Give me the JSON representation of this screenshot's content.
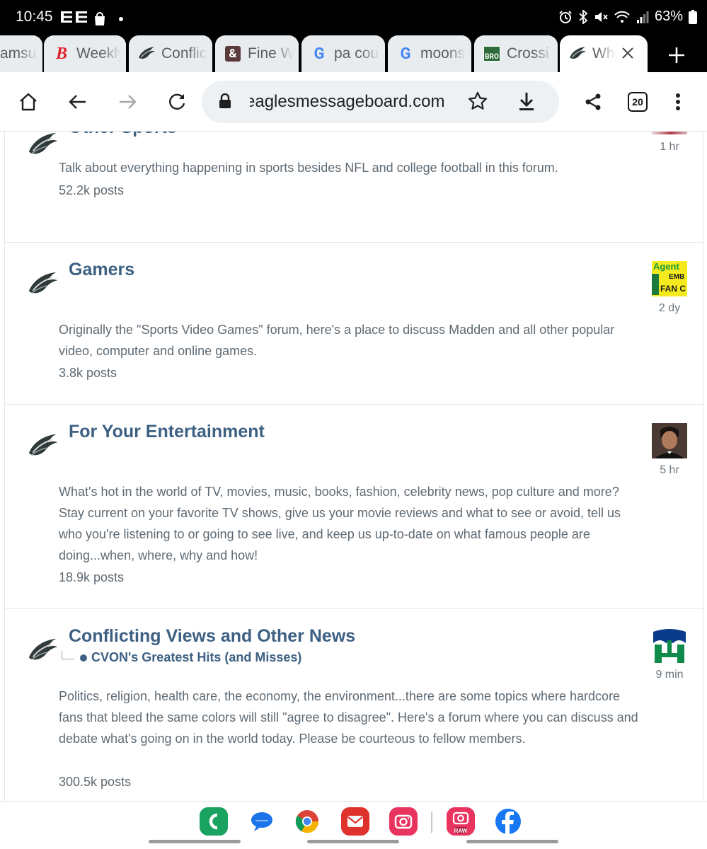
{
  "status_bar": {
    "time": "10:45",
    "battery": "63%"
  },
  "tabs": [
    {
      "label": "amsu",
      "favicon": "generic"
    },
    {
      "label": "Weekly",
      "favicon": "b-logo"
    },
    {
      "label": "Conflic",
      "favicon": "eagle"
    },
    {
      "label": "Fine W",
      "favicon": "ampersand"
    },
    {
      "label": "pa cou",
      "favicon": "google"
    },
    {
      "label": "moons",
      "favicon": "google"
    },
    {
      "label": "Crossi",
      "favicon": "bro"
    },
    {
      "label": "Wh",
      "favicon": "eagle"
    }
  ],
  "favicon_labels": {
    "ampersand": "&",
    "bro": "BRO",
    "google": "G",
    "b_logo": "B"
  },
  "toolbar": {
    "url": "eaglesmessageboard.com",
    "tab_count": "20"
  },
  "forums": [
    {
      "title": "Other Sports",
      "description": "Talk about everything happening in sports besides NFL and college football in this forum.",
      "posts": "52.2k posts",
      "last_post": "1 hr",
      "avatar": "sports-photo"
    },
    {
      "title": "Gamers",
      "description": "Originally the \"Sports Video Games\" forum, here's a place to discuss Madden and all other popular video, computer and online games.",
      "posts": "3.8k posts",
      "last_post": "2 dy",
      "avatar": "agent-emb",
      "avatar_text": [
        "Agent",
        "EMB",
        "FAN C"
      ]
    },
    {
      "title": "For Your Entertainment",
      "description": "What's hot in the world of TV, movies, music, books, fashion, celebrity news, pop culture and more? Stay current on your favorite TV shows, give us your movie reviews and what to see or avoid, tell us who you're listening to or going to see live, and keep us up-to-date on what famous people are doing...when, where, why and how!",
      "posts": "18.9k posts",
      "last_post": "5 hr",
      "avatar": "man-in-tuxedo"
    },
    {
      "title": "Conflicting Views and Other News",
      "subforum": "CVON's Greatest Hits (and Misses)",
      "description": "Politics, religion, health care, the economy, the environment...there are some topics where hardcore fans that bleed the same colors will still \"agree to disagree\". Here's a forum where you can discuss and debate what's going on in the world today. Please be courteous to fellow members.",
      "posts": "300.5k posts",
      "last_post": "9 min",
      "avatar": "whalers-logo"
    }
  ],
  "dock": [
    {
      "name": "phone",
      "color": "#1aa260"
    },
    {
      "name": "messages",
      "color": "#1a73e8"
    },
    {
      "name": "chrome",
      "color": "#ffffff"
    },
    {
      "name": "email",
      "color": "#e0322d"
    },
    {
      "name": "camera",
      "color": "#e8345f"
    },
    {
      "name": "raw-camera",
      "color": "#e8345f",
      "label": "RAW"
    },
    {
      "name": "facebook",
      "color": "#1877f2"
    }
  ],
  "colors": {
    "forum_title": "#3d6083",
    "body_text": "#5f6a73"
  }
}
